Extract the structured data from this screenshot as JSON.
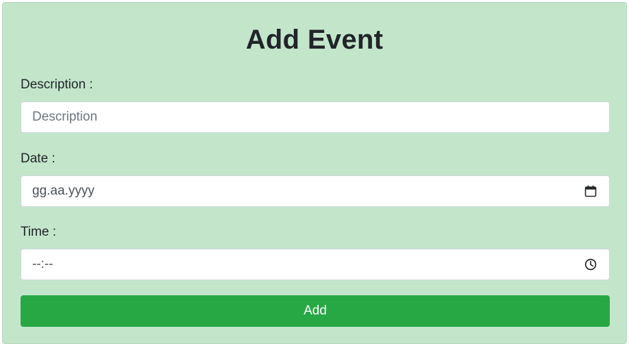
{
  "form": {
    "title": "Add Event",
    "description": {
      "label": "Description :",
      "placeholder": "Description",
      "value": ""
    },
    "date": {
      "label": "Date :",
      "display_text": "gg.aa.yyyy",
      "icon": "calendar-icon"
    },
    "time": {
      "label": "Time :",
      "display_text": "--:--",
      "icon": "clock-icon"
    },
    "submit_label": "Add"
  },
  "colors": {
    "panel_background": "#c3e6cb",
    "button_background": "#28a745",
    "button_text": "#ffffff",
    "input_background": "#ffffff"
  }
}
